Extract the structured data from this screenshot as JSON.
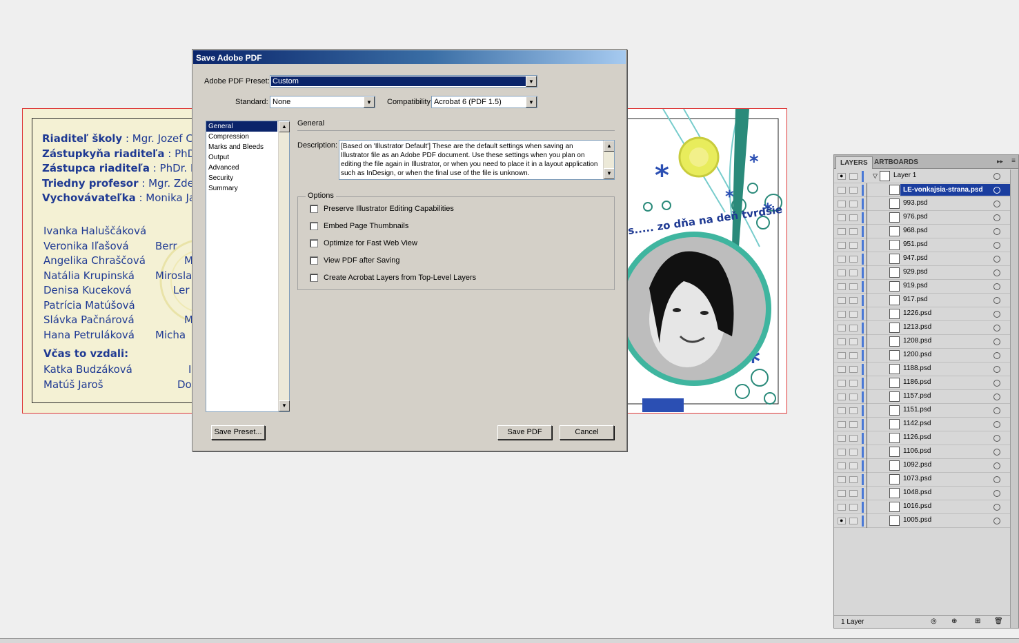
{
  "dialog": {
    "title": "Save Adobe PDF",
    "preset_label": "Adobe PDF Preset:",
    "preset_value": "Custom",
    "standard_label": "Standard:",
    "standard_value": "None",
    "compat_label": "Compatibility:",
    "compat_value": "Acrobat 6 (PDF 1.5)",
    "nav": [
      "General",
      "Compression",
      "Marks and Bleeds",
      "Output",
      "Advanced",
      "Security",
      "Summary"
    ],
    "section_title": "General",
    "desc_label": "Description:",
    "description": "[Based on 'Illustrator Default'] These are the default settings when saving an Illustrator file as an Adobe PDF document. Use these settings when you plan on editing the file again in Illustrator, or when you need to place it in a layout application such as InDesign, or when the final use of the file is unknown.",
    "options_legend": "Options",
    "options": [
      "Preserve Illustrator Editing Capabilities",
      "Embed Page Thumbnails",
      "Optimize for Fast Web View",
      "View PDF after Saving",
      "Create Acrobat Layers from Top-Level Layers"
    ],
    "save_preset": "Save Preset...",
    "save_pdf": "Save PDF",
    "cancel": "Cancel"
  },
  "artboard_left": {
    "staff": [
      {
        "role": "Riaditeľ školy",
        "name": " : Mgr. Jozef Cir"
      },
      {
        "role": "Zástupkyňa riaditeľa",
        "name": " : PhDr. "
      },
      {
        "role": "Zástupca riaditeľa",
        "name": " : PhDr. Ľuľ"
      },
      {
        "role": "Triedny profesor",
        "name": " : Mgr. Zden"
      },
      {
        "role": "Vychovávateľka",
        "name": " : Monika Jak"
      }
    ],
    "students_col1": [
      "Ivanka Haluščáková",
      "Veronika  Iľašová",
      "Angelika Chraščová",
      "Natália Krupinská",
      "Denisa Kuceková",
      "Patrícia Matúšová",
      "Slávka  Pačnárová",
      "Hana Petruláková"
    ],
    "students_col2": [
      "",
      "Berr",
      "M",
      "Mirosla",
      "Ler",
      "",
      "M",
      "Micha"
    ],
    "gave_up_title": "Včas to vzdali:",
    "gave_up": [
      "Katka Budzáková",
      "Matúš Jaroš"
    ],
    "gave_up_col2": [
      "I",
      "Do"
    ]
  },
  "artboard_right": {
    "motto": "s..... zo dňa na deň tvrdšie"
  },
  "layers_panel": {
    "tabs": [
      "LAYERS",
      "ARTBOARDS"
    ],
    "layer_name": "Layer 1",
    "selected_item": "LE-vonkajsia-strana.psd",
    "items": [
      "993.psd",
      "976.psd",
      "968.psd",
      "951.psd",
      "947.psd",
      "929.psd",
      "919.psd",
      "917.psd",
      "1226.psd",
      "1213.psd",
      "1208.psd",
      "1200.psd",
      "1188.psd",
      "1186.psd",
      "1157.psd",
      "1151.psd",
      "1142.psd",
      "1126.psd",
      "1106.psd",
      "1092.psd",
      "1073.psd",
      "1048.psd",
      "1016.psd",
      "1005.psd"
    ],
    "footer": "1 Layer"
  },
  "colors": {
    "title_bar": "#0a246a",
    "text_blue": "#1f3a93",
    "selection": "#1b3e9f",
    "artboard_border": "#dd3333"
  }
}
